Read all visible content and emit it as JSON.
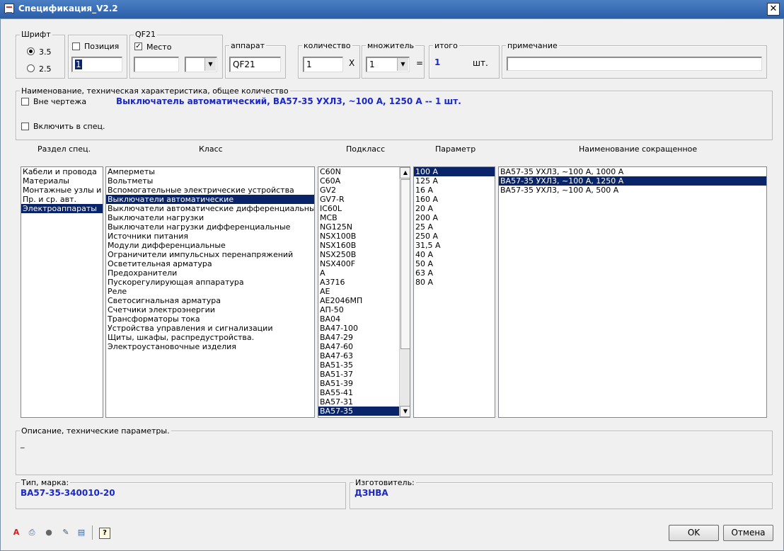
{
  "window": {
    "title": "Спецификация_V2.2",
    "close_glyph": "✕"
  },
  "font_group": {
    "legend": "Шрифт",
    "options": [
      "3.5",
      "2.5"
    ],
    "selected": "3.5"
  },
  "position": {
    "checkbox_label": "Позиция",
    "checked": false,
    "value": "1"
  },
  "qf_group": {
    "legend": "QF21",
    "place_label": "Место",
    "place_checked": true,
    "place_value": "",
    "combo_value": ""
  },
  "apparatus": {
    "legend": "аппарат",
    "value": "QF21"
  },
  "quantity": {
    "legend": "количество",
    "value": "1",
    "times": "X"
  },
  "multiplier": {
    "legend": "множитель",
    "value": "1",
    "equals": "="
  },
  "total": {
    "legend": "итого",
    "value": "1",
    "unit": "шт."
  },
  "note": {
    "legend": "примечание",
    "value": ""
  },
  "naming": {
    "legend": "Наименование, техническая характеристика, общее количество",
    "outside_label": "Вне чертежа",
    "include_label": "Включить в спец.",
    "summary": "Выключатель автоматический, ВА57-35 УХЛ3, ~100 А, 1250 А -- 1 шт."
  },
  "columns": {
    "section": "Раздел спец.",
    "class": "Класс",
    "subclass": "Подкласс",
    "parameter": "Параметр",
    "short_name": "Наименование сокращенное"
  },
  "sections": {
    "items": [
      "Кабели и провода",
      "Материалы",
      "Монтажные узлы и изделия",
      "Пр. и ср. авт.",
      "Электроаппараты"
    ],
    "selected": 4
  },
  "classes": {
    "items": [
      "Амперметы",
      "Вольтметы",
      "Вспомогательные электрические устройства",
      "Выключатели автоматические",
      "Выключатели автоматические дифференциальные",
      "Выключатели нагрузки",
      "Выключатели нагрузки дифференциальные",
      "Источники питания",
      "Модули дифференциальные",
      "Ограничители импульсных перенапряжений",
      "Осветительная арматура",
      "Предохранители",
      "Пускорегулирующая аппаратура",
      "Реле",
      "Светосигнальная арматура",
      "Счетчики электроэнергии",
      "Трансформаторы тока",
      "Устройства управления и сигнализации",
      "Щиты, шкафы, распредустройства.",
      "Электроустановочные изделия"
    ],
    "selected": 3
  },
  "subclasses": {
    "items": [
      "C60N",
      "C60A",
      "GV2",
      "GV7-R",
      "IC60L",
      "MCB",
      "NG125N",
      "NSX100B",
      "NSX160B",
      "NSX250B",
      "NSX400F",
      "A",
      "A3716",
      "AE",
      "AE2046МП",
      "АП-50",
      "BA04",
      "BA47-100",
      "BA47-29",
      "BA47-60",
      "BA47-63",
      "BA51-35",
      "BA51-37",
      "BA51-39",
      "BA55-41",
      "BA57-31",
      "BA57-35"
    ],
    "selected": 26
  },
  "parameters": {
    "items": [
      "100 A",
      "125 A",
      "16 A",
      "160 A",
      "20 A",
      "200 A",
      "25 A",
      "250 A",
      "31,5 A",
      "40 A",
      "50 A",
      "63 A",
      "80 A"
    ],
    "selected": 0
  },
  "short_names": {
    "items": [
      "ВА57-35 УХЛ3, ~100 А, 1000 А",
      "ВА57-35 УХЛ3, ~100 А, 1250 А",
      "ВА57-35 УХЛ3, ~100 А, 500 А"
    ],
    "selected": 1
  },
  "description": {
    "legend": "Описание, технические параметры.",
    "value": "_"
  },
  "type_mark": {
    "legend": "Тип, марка:",
    "value": "ВА57-35-340010-20"
  },
  "manufacturer": {
    "legend": "Изготовитель:",
    "value": "ДЗНВА"
  },
  "toolbar_icons": [
    "text-color-icon",
    "print-icon",
    "lightbulb-icon",
    "edit-document-icon",
    "document-icon",
    "help-icon"
  ],
  "buttons": {
    "ok": "OK",
    "cancel": "Отмена"
  },
  "colors": {
    "selection": "#0a246a",
    "accent_text": "#1a27c9"
  }
}
